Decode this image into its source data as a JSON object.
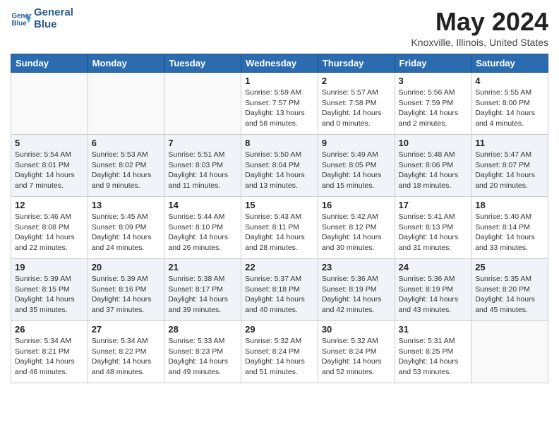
{
  "header": {
    "logo_line1": "General",
    "logo_line2": "Blue",
    "month": "May 2024",
    "location": "Knoxville, Illinois, United States"
  },
  "days_of_week": [
    "Sunday",
    "Monday",
    "Tuesday",
    "Wednesday",
    "Thursday",
    "Friday",
    "Saturday"
  ],
  "weeks": [
    [
      {
        "day": "",
        "info": ""
      },
      {
        "day": "",
        "info": ""
      },
      {
        "day": "",
        "info": ""
      },
      {
        "day": "1",
        "info": "Sunrise: 5:59 AM\nSunset: 7:57 PM\nDaylight: 13 hours\nand 58 minutes."
      },
      {
        "day": "2",
        "info": "Sunrise: 5:57 AM\nSunset: 7:58 PM\nDaylight: 14 hours\nand 0 minutes."
      },
      {
        "day": "3",
        "info": "Sunrise: 5:56 AM\nSunset: 7:59 PM\nDaylight: 14 hours\nand 2 minutes."
      },
      {
        "day": "4",
        "info": "Sunrise: 5:55 AM\nSunset: 8:00 PM\nDaylight: 14 hours\nand 4 minutes."
      }
    ],
    [
      {
        "day": "5",
        "info": "Sunrise: 5:54 AM\nSunset: 8:01 PM\nDaylight: 14 hours\nand 7 minutes."
      },
      {
        "day": "6",
        "info": "Sunrise: 5:53 AM\nSunset: 8:02 PM\nDaylight: 14 hours\nand 9 minutes."
      },
      {
        "day": "7",
        "info": "Sunrise: 5:51 AM\nSunset: 8:03 PM\nDaylight: 14 hours\nand 11 minutes."
      },
      {
        "day": "8",
        "info": "Sunrise: 5:50 AM\nSunset: 8:04 PM\nDaylight: 14 hours\nand 13 minutes."
      },
      {
        "day": "9",
        "info": "Sunrise: 5:49 AM\nSunset: 8:05 PM\nDaylight: 14 hours\nand 15 minutes."
      },
      {
        "day": "10",
        "info": "Sunrise: 5:48 AM\nSunset: 8:06 PM\nDaylight: 14 hours\nand 18 minutes."
      },
      {
        "day": "11",
        "info": "Sunrise: 5:47 AM\nSunset: 8:07 PM\nDaylight: 14 hours\nand 20 minutes."
      }
    ],
    [
      {
        "day": "12",
        "info": "Sunrise: 5:46 AM\nSunset: 8:08 PM\nDaylight: 14 hours\nand 22 minutes."
      },
      {
        "day": "13",
        "info": "Sunrise: 5:45 AM\nSunset: 8:09 PM\nDaylight: 14 hours\nand 24 minutes."
      },
      {
        "day": "14",
        "info": "Sunrise: 5:44 AM\nSunset: 8:10 PM\nDaylight: 14 hours\nand 26 minutes."
      },
      {
        "day": "15",
        "info": "Sunrise: 5:43 AM\nSunset: 8:11 PM\nDaylight: 14 hours\nand 28 minutes."
      },
      {
        "day": "16",
        "info": "Sunrise: 5:42 AM\nSunset: 8:12 PM\nDaylight: 14 hours\nand 30 minutes."
      },
      {
        "day": "17",
        "info": "Sunrise: 5:41 AM\nSunset: 8:13 PM\nDaylight: 14 hours\nand 31 minutes."
      },
      {
        "day": "18",
        "info": "Sunrise: 5:40 AM\nSunset: 8:14 PM\nDaylight: 14 hours\nand 33 minutes."
      }
    ],
    [
      {
        "day": "19",
        "info": "Sunrise: 5:39 AM\nSunset: 8:15 PM\nDaylight: 14 hours\nand 35 minutes."
      },
      {
        "day": "20",
        "info": "Sunrise: 5:39 AM\nSunset: 8:16 PM\nDaylight: 14 hours\nand 37 minutes."
      },
      {
        "day": "21",
        "info": "Sunrise: 5:38 AM\nSunset: 8:17 PM\nDaylight: 14 hours\nand 39 minutes."
      },
      {
        "day": "22",
        "info": "Sunrise: 5:37 AM\nSunset: 8:18 PM\nDaylight: 14 hours\nand 40 minutes."
      },
      {
        "day": "23",
        "info": "Sunrise: 5:36 AM\nSunset: 8:19 PM\nDaylight: 14 hours\nand 42 minutes."
      },
      {
        "day": "24",
        "info": "Sunrise: 5:36 AM\nSunset: 8:19 PM\nDaylight: 14 hours\nand 43 minutes."
      },
      {
        "day": "25",
        "info": "Sunrise: 5:35 AM\nSunset: 8:20 PM\nDaylight: 14 hours\nand 45 minutes."
      }
    ],
    [
      {
        "day": "26",
        "info": "Sunrise: 5:34 AM\nSunset: 8:21 PM\nDaylight: 14 hours\nand 46 minutes."
      },
      {
        "day": "27",
        "info": "Sunrise: 5:34 AM\nSunset: 8:22 PM\nDaylight: 14 hours\nand 48 minutes."
      },
      {
        "day": "28",
        "info": "Sunrise: 5:33 AM\nSunset: 8:23 PM\nDaylight: 14 hours\nand 49 minutes."
      },
      {
        "day": "29",
        "info": "Sunrise: 5:32 AM\nSunset: 8:24 PM\nDaylight: 14 hours\nand 51 minutes."
      },
      {
        "day": "30",
        "info": "Sunrise: 5:32 AM\nSunset: 8:24 PM\nDaylight: 14 hours\nand 52 minutes."
      },
      {
        "day": "31",
        "info": "Sunrise: 5:31 AM\nSunset: 8:25 PM\nDaylight: 14 hours\nand 53 minutes."
      },
      {
        "day": "",
        "info": ""
      }
    ]
  ]
}
